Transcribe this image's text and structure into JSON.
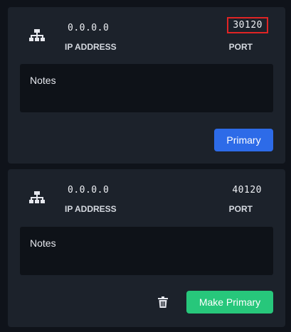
{
  "endpoints": [
    {
      "ip_address": "0.0.0.0",
      "ip_label": "IP ADDRESS",
      "port": "30120",
      "port_label": "PORT",
      "notes_placeholder": "Notes",
      "action_label": "Primary"
    },
    {
      "ip_address": "0.0.0.0",
      "ip_label": "IP ADDRESS",
      "port": "40120",
      "port_label": "PORT",
      "notes_placeholder": "Notes",
      "action_label": "Make Primary"
    }
  ],
  "icons": {
    "network": "network-icon",
    "delete": "trash-icon"
  },
  "colors": {
    "primary": "#2d6be8",
    "make_primary": "#27c77b",
    "highlight": "#e02424"
  }
}
